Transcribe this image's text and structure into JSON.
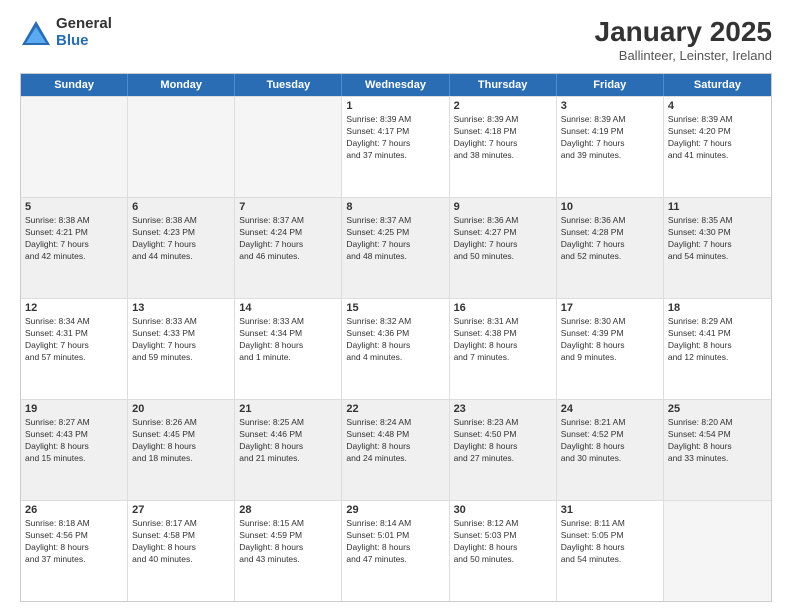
{
  "logo": {
    "general": "General",
    "blue": "Blue"
  },
  "title": "January 2025",
  "subtitle": "Ballinteer, Leinster, Ireland",
  "days": [
    "Sunday",
    "Monday",
    "Tuesday",
    "Wednesday",
    "Thursday",
    "Friday",
    "Saturday"
  ],
  "weeks": [
    [
      {
        "day": "",
        "info": ""
      },
      {
        "day": "",
        "info": ""
      },
      {
        "day": "",
        "info": ""
      },
      {
        "day": "1",
        "info": "Sunrise: 8:39 AM\nSunset: 4:17 PM\nDaylight: 7 hours\nand 37 minutes."
      },
      {
        "day": "2",
        "info": "Sunrise: 8:39 AM\nSunset: 4:18 PM\nDaylight: 7 hours\nand 38 minutes."
      },
      {
        "day": "3",
        "info": "Sunrise: 8:39 AM\nSunset: 4:19 PM\nDaylight: 7 hours\nand 39 minutes."
      },
      {
        "day": "4",
        "info": "Sunrise: 8:39 AM\nSunset: 4:20 PM\nDaylight: 7 hours\nand 41 minutes."
      }
    ],
    [
      {
        "day": "5",
        "info": "Sunrise: 8:38 AM\nSunset: 4:21 PM\nDaylight: 7 hours\nand 42 minutes."
      },
      {
        "day": "6",
        "info": "Sunrise: 8:38 AM\nSunset: 4:23 PM\nDaylight: 7 hours\nand 44 minutes."
      },
      {
        "day": "7",
        "info": "Sunrise: 8:37 AM\nSunset: 4:24 PM\nDaylight: 7 hours\nand 46 minutes."
      },
      {
        "day": "8",
        "info": "Sunrise: 8:37 AM\nSunset: 4:25 PM\nDaylight: 7 hours\nand 48 minutes."
      },
      {
        "day": "9",
        "info": "Sunrise: 8:36 AM\nSunset: 4:27 PM\nDaylight: 7 hours\nand 50 minutes."
      },
      {
        "day": "10",
        "info": "Sunrise: 8:36 AM\nSunset: 4:28 PM\nDaylight: 7 hours\nand 52 minutes."
      },
      {
        "day": "11",
        "info": "Sunrise: 8:35 AM\nSunset: 4:30 PM\nDaylight: 7 hours\nand 54 minutes."
      }
    ],
    [
      {
        "day": "12",
        "info": "Sunrise: 8:34 AM\nSunset: 4:31 PM\nDaylight: 7 hours\nand 57 minutes."
      },
      {
        "day": "13",
        "info": "Sunrise: 8:33 AM\nSunset: 4:33 PM\nDaylight: 7 hours\nand 59 minutes."
      },
      {
        "day": "14",
        "info": "Sunrise: 8:33 AM\nSunset: 4:34 PM\nDaylight: 8 hours\nand 1 minute."
      },
      {
        "day": "15",
        "info": "Sunrise: 8:32 AM\nSunset: 4:36 PM\nDaylight: 8 hours\nand 4 minutes."
      },
      {
        "day": "16",
        "info": "Sunrise: 8:31 AM\nSunset: 4:38 PM\nDaylight: 8 hours\nand 7 minutes."
      },
      {
        "day": "17",
        "info": "Sunrise: 8:30 AM\nSunset: 4:39 PM\nDaylight: 8 hours\nand 9 minutes."
      },
      {
        "day": "18",
        "info": "Sunrise: 8:29 AM\nSunset: 4:41 PM\nDaylight: 8 hours\nand 12 minutes."
      }
    ],
    [
      {
        "day": "19",
        "info": "Sunrise: 8:27 AM\nSunset: 4:43 PM\nDaylight: 8 hours\nand 15 minutes."
      },
      {
        "day": "20",
        "info": "Sunrise: 8:26 AM\nSunset: 4:45 PM\nDaylight: 8 hours\nand 18 minutes."
      },
      {
        "day": "21",
        "info": "Sunrise: 8:25 AM\nSunset: 4:46 PM\nDaylight: 8 hours\nand 21 minutes."
      },
      {
        "day": "22",
        "info": "Sunrise: 8:24 AM\nSunset: 4:48 PM\nDaylight: 8 hours\nand 24 minutes."
      },
      {
        "day": "23",
        "info": "Sunrise: 8:23 AM\nSunset: 4:50 PM\nDaylight: 8 hours\nand 27 minutes."
      },
      {
        "day": "24",
        "info": "Sunrise: 8:21 AM\nSunset: 4:52 PM\nDaylight: 8 hours\nand 30 minutes."
      },
      {
        "day": "25",
        "info": "Sunrise: 8:20 AM\nSunset: 4:54 PM\nDaylight: 8 hours\nand 33 minutes."
      }
    ],
    [
      {
        "day": "26",
        "info": "Sunrise: 8:18 AM\nSunset: 4:56 PM\nDaylight: 8 hours\nand 37 minutes."
      },
      {
        "day": "27",
        "info": "Sunrise: 8:17 AM\nSunset: 4:58 PM\nDaylight: 8 hours\nand 40 minutes."
      },
      {
        "day": "28",
        "info": "Sunrise: 8:15 AM\nSunset: 4:59 PM\nDaylight: 8 hours\nand 43 minutes."
      },
      {
        "day": "29",
        "info": "Sunrise: 8:14 AM\nSunset: 5:01 PM\nDaylight: 8 hours\nand 47 minutes."
      },
      {
        "day": "30",
        "info": "Sunrise: 8:12 AM\nSunset: 5:03 PM\nDaylight: 8 hours\nand 50 minutes."
      },
      {
        "day": "31",
        "info": "Sunrise: 8:11 AM\nSunset: 5:05 PM\nDaylight: 8 hours\nand 54 minutes."
      },
      {
        "day": "",
        "info": ""
      }
    ]
  ],
  "alt_rows": [
    1,
    3
  ]
}
